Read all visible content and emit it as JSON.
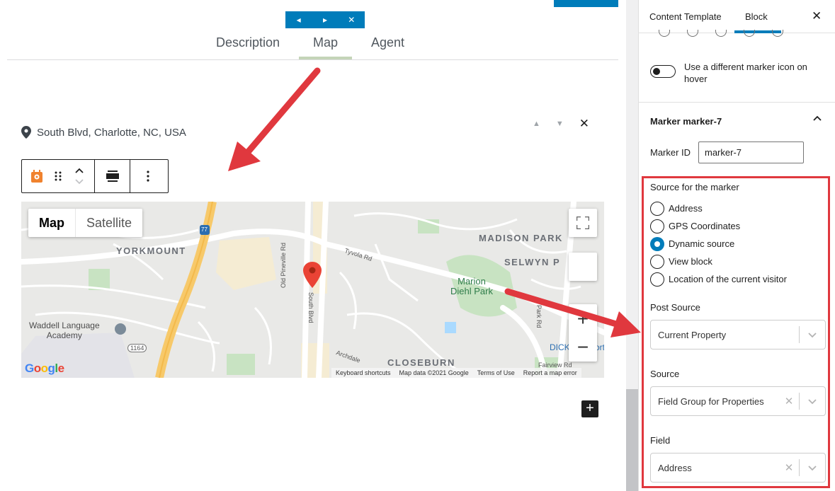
{
  "carousel_controls": {
    "prev": "◂",
    "next": "▸",
    "close": "✕"
  },
  "tabs": [
    {
      "label": "Description"
    },
    {
      "label": "Map"
    },
    {
      "label": "Agent"
    }
  ],
  "location": {
    "text": "South Blvd, Charlotte, NC, USA"
  },
  "map": {
    "type_buttons": {
      "map": "Map",
      "satellite": "Satellite"
    },
    "labels": {
      "yorkmount": "YORKMOUNT",
      "madison_park": "MADISON PARK",
      "selwyn": "SELWYN P",
      "closeburn": "CLOSEBURN",
      "marion": "Marion",
      "diehl_park": "Diehl Park",
      "waddell": "Waddell Language",
      "academy": "Academy",
      "dick": "DICK",
      "dick_suffix": "ort",
      "route": "1164",
      "i77": "77"
    },
    "roads": {
      "old_pineville": "Old Pineville Rd",
      "south_blvd": "South Blvd",
      "tyvola": "Tyvola Rd",
      "park_rd": "Park Rd",
      "archdale": "Archdale",
      "fairview": "Fairview Rd"
    },
    "logo": "Google",
    "footer": {
      "shortcuts": "Keyboard shortcuts",
      "data": "Map data ©2021 Google",
      "terms": "Terms of Use",
      "report": "Report a map error"
    },
    "zoom_in": "+",
    "zoom_out": "−"
  },
  "add_block": "+",
  "sidebar": {
    "tabs": {
      "content_template": "Content Template",
      "block": "Block"
    },
    "close": "✕",
    "hover_toggle_label": "Use a different marker icon on hover",
    "marker_panel_title": "Marker marker-7",
    "marker_id_label": "Marker ID",
    "marker_id_value": "marker-7",
    "source_for_marker_label": "Source for the marker",
    "source_options": [
      {
        "label": "Address",
        "checked": false
      },
      {
        "label": "GPS Coordinates",
        "checked": false
      },
      {
        "label": "Dynamic source",
        "checked": true
      },
      {
        "label": "View block",
        "checked": false
      },
      {
        "label": "Location of the current visitor",
        "checked": false
      }
    ],
    "post_source_label": "Post Source",
    "post_source_value": "Current Property",
    "source_label": "Source",
    "source_value": "Field Group for Properties",
    "field_label": "Field",
    "field_value": "Address",
    "clear_glyph": "✕"
  },
  "colors": {
    "wp_blue": "#007cba",
    "annotation_red": "#e0383e",
    "marker_red": "#ea4335",
    "toolbar_icon_orange": "#f0822e"
  }
}
